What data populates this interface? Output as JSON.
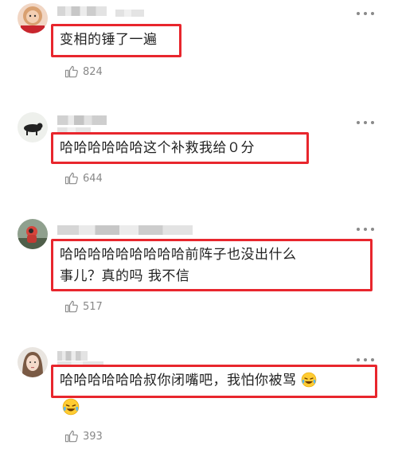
{
  "comments": [
    {
      "text": "变相的锤了一遍",
      "likes": "824"
    },
    {
      "text": "哈哈哈哈哈哈这个补救我给０分",
      "likes": "644"
    },
    {
      "text_line1": "哈哈哈哈哈哈哈哈哈前阵子也没出什么",
      "text_line2": "事儿？真的吗 我不信",
      "likes": "517"
    },
    {
      "text": "哈哈哈哈哈哈叔你闭嘴吧，我怕你被骂",
      "likes": "393"
    }
  ],
  "icons": {
    "more": "more-options-icon",
    "like": "thumbs-up-icon",
    "emoji": "laughing-tears-emoji"
  },
  "colors": {
    "highlight_border": "#e8262d",
    "text": "#222222",
    "meta": "#888888"
  }
}
